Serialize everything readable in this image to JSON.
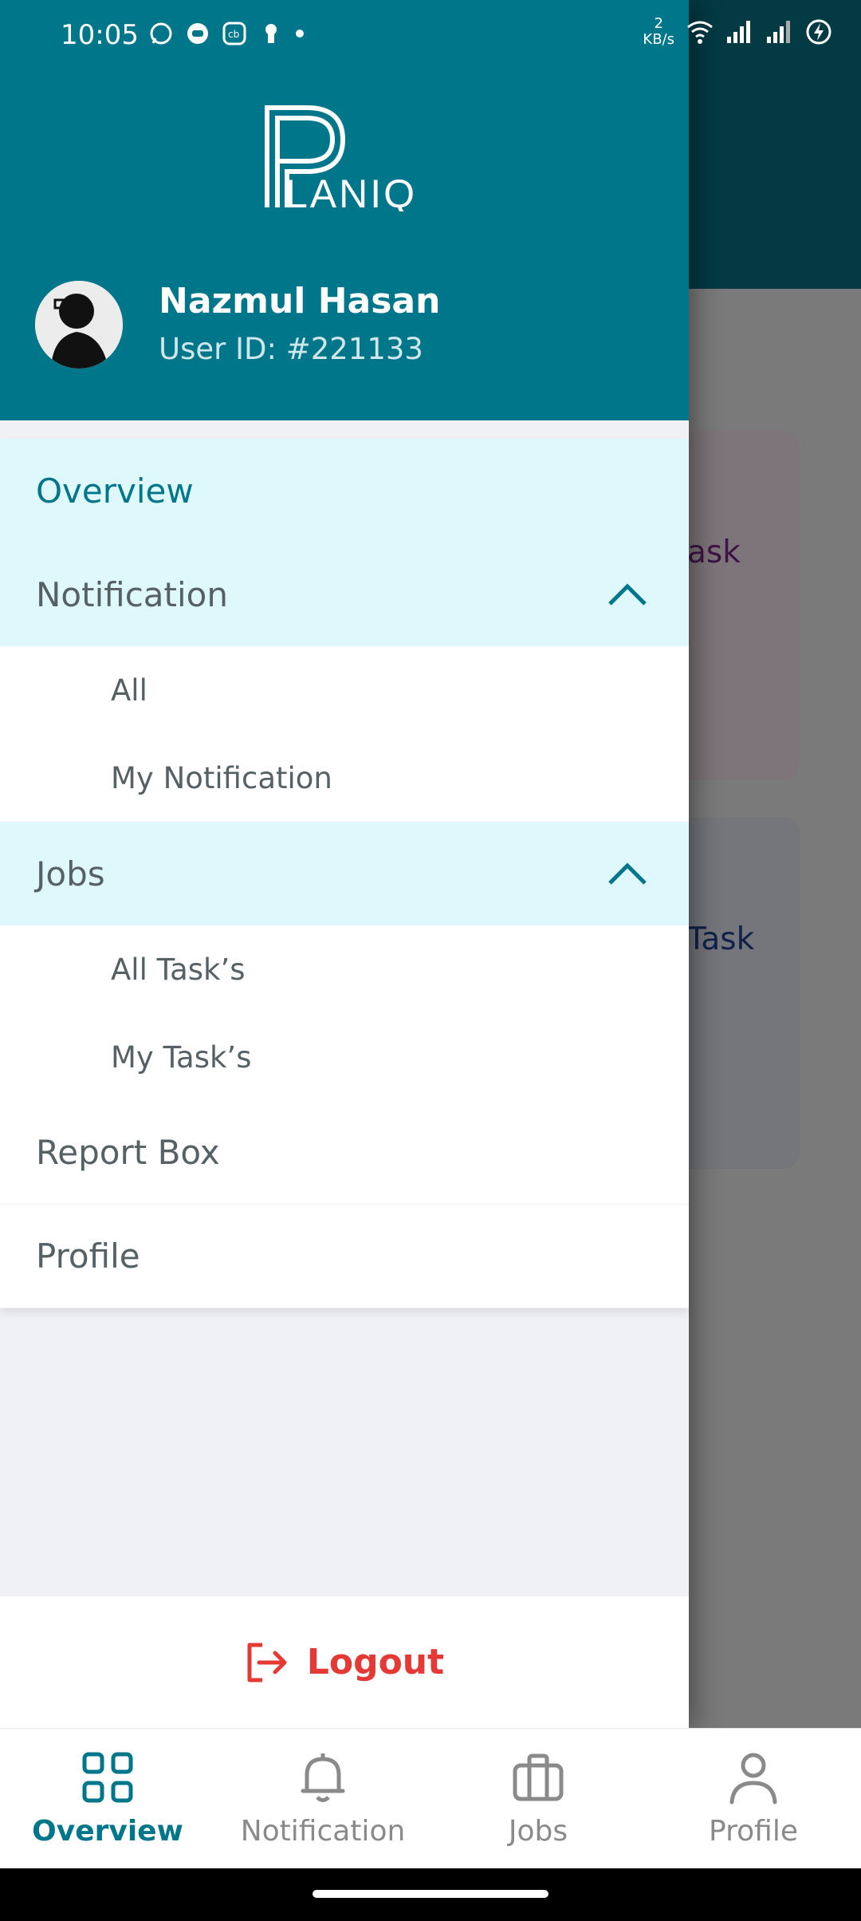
{
  "status_bar": {
    "time": "10:05",
    "net_speed_value": "2",
    "net_speed_unit": "KB/s",
    "icons": [
      "whatsapp-icon",
      "messenger-bot-icon",
      "cb-app-icon",
      "keyhole-icon",
      "dot-icon",
      "wifi-icon",
      "signal-icon",
      "signal-icon-2",
      "battery-charging-icon"
    ]
  },
  "drawer": {
    "logo_text": "LANIQ",
    "user": {
      "name": "Nazmul Hasan",
      "id": "User ID: #221133"
    },
    "menu": {
      "overview": "Overview",
      "notification": "Notification",
      "notification_sub": [
        "All",
        "My Notification"
      ],
      "jobs": "Jobs",
      "jobs_sub": [
        "All Task’s",
        "My Task’s"
      ],
      "report_box": "Report Box",
      "profile": "Profile"
    },
    "logout": "Logout"
  },
  "background": {
    "card1_text": "ask",
    "card2_text": "Task"
  },
  "bottom_nav": {
    "items": [
      {
        "label": "Overview",
        "icon": "grid-icon",
        "active": true
      },
      {
        "label": "Notification",
        "icon": "bell-icon",
        "active": false
      },
      {
        "label": "Jobs",
        "icon": "briefcase-icon",
        "active": false
      },
      {
        "label": "Profile",
        "icon": "person-icon",
        "active": false
      }
    ]
  },
  "colors": {
    "primary": "#00768b",
    "active_bg": "#dff8fc",
    "logout": "#e53935"
  }
}
